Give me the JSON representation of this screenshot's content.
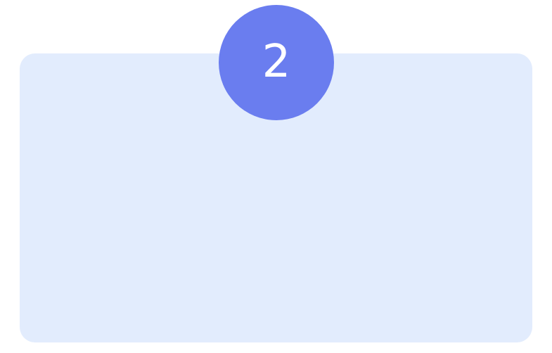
{
  "step": {
    "number": "2"
  },
  "colors": {
    "panel_background": "#e2ecfd",
    "badge_background": "#6a7def",
    "badge_text": "#ffffff",
    "page_background": "#ffffff"
  }
}
